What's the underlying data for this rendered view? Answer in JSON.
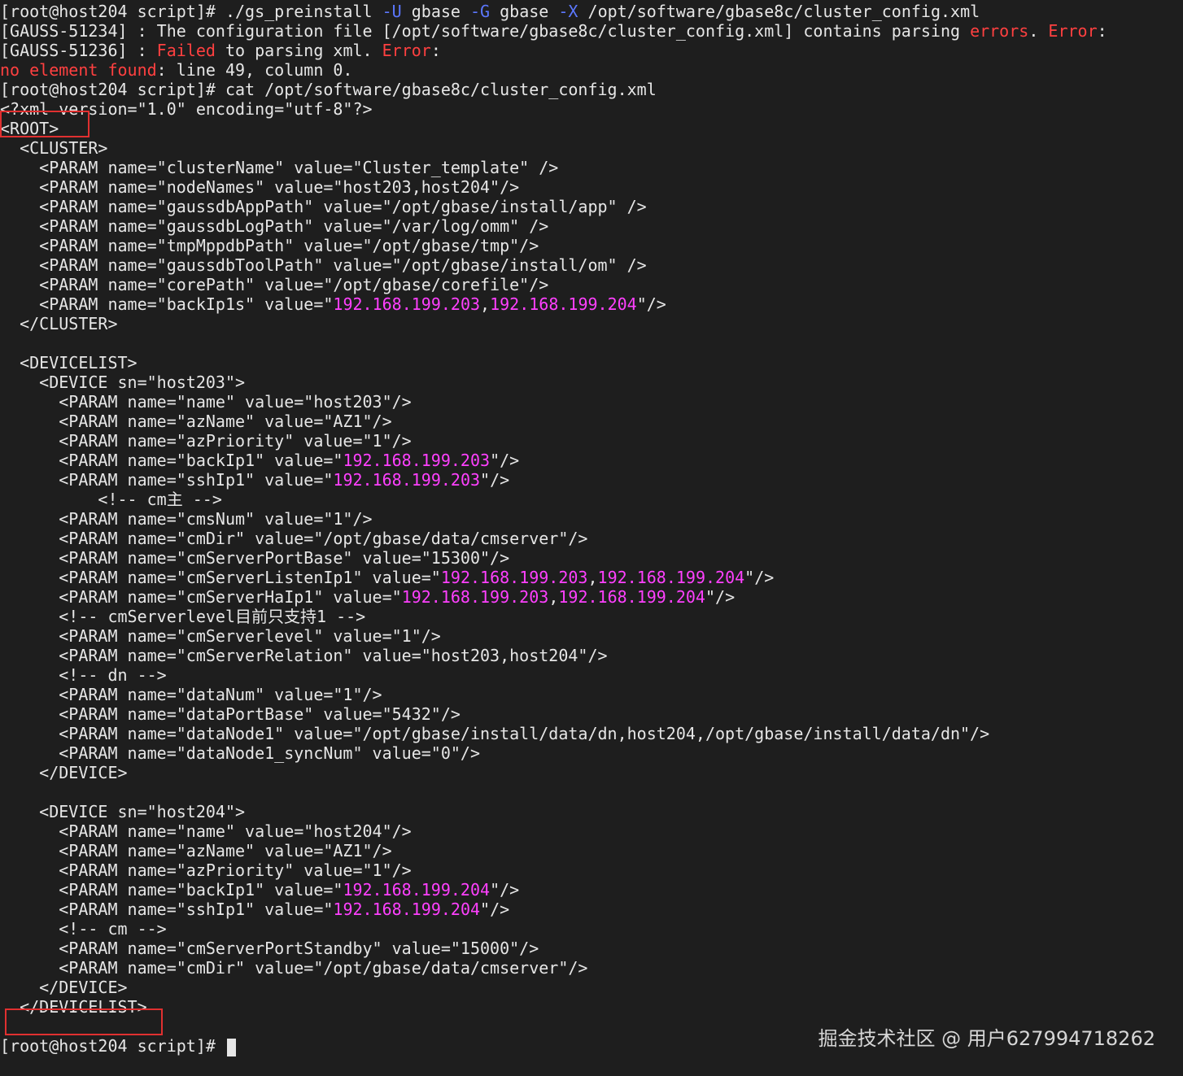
{
  "terminal": {
    "lines": [
      [
        {
          "t": "[root@host204 script]# ./gs_preinstall ",
          "c": "n"
        },
        {
          "t": "-U",
          "c": "b"
        },
        {
          "t": " gbase ",
          "c": "n"
        },
        {
          "t": "-G",
          "c": "b"
        },
        {
          "t": " gbase ",
          "c": "n"
        },
        {
          "t": "-X",
          "c": "b"
        },
        {
          "t": " /opt/software/gbase8c/cluster_config.xml",
          "c": "n"
        }
      ],
      [
        {
          "t": "[GAUSS-51234] : The configuration file [/opt/software/gbase8c/cluster_config.xml] contains parsing ",
          "c": "n"
        },
        {
          "t": "errors",
          "c": "r"
        },
        {
          "t": ". ",
          "c": "n"
        },
        {
          "t": "Error",
          "c": "r"
        },
        {
          "t": ":",
          "c": "n"
        }
      ],
      [
        {
          "t": "[GAUSS-51236] : ",
          "c": "n"
        },
        {
          "t": "Failed",
          "c": "r"
        },
        {
          "t": " to parsing xml. ",
          "c": "n"
        },
        {
          "t": "Error",
          "c": "r"
        },
        {
          "t": ":",
          "c": "n"
        }
      ],
      [
        {
          "t": "no element found",
          "c": "r"
        },
        {
          "t": ": line 49, column 0.",
          "c": "n"
        }
      ],
      [
        {
          "t": "[root@host204 script]# cat /opt/software/gbase8c/cluster_config.xml",
          "c": "n"
        }
      ],
      [
        {
          "t": "<?xml version=\"1.0\" encoding=\"utf-8\"?>",
          "c": "n"
        }
      ],
      [
        {
          "t": "<ROOT>",
          "c": "n"
        }
      ],
      [
        {
          "t": "  <CLUSTER>",
          "c": "n"
        }
      ],
      [
        {
          "t": "    <PARAM name=\"clusterName\" value=\"Cluster_template\" />",
          "c": "n"
        }
      ],
      [
        {
          "t": "    <PARAM name=\"nodeNames\" value=\"host203,host204\"/>",
          "c": "n"
        }
      ],
      [
        {
          "t": "    <PARAM name=\"gaussdbAppPath\" value=\"/opt/gbase/install/app\" />",
          "c": "n"
        }
      ],
      [
        {
          "t": "    <PARAM name=\"gaussdbLogPath\" value=\"/var/log/omm\" />",
          "c": "n"
        }
      ],
      [
        {
          "t": "    <PARAM name=\"tmpMppdbPath\" value=\"/opt/gbase/tmp\"/>",
          "c": "n"
        }
      ],
      [
        {
          "t": "    <PARAM name=\"gaussdbToolPath\" value=\"/opt/gbase/install/om\" />",
          "c": "n"
        }
      ],
      [
        {
          "t": "    <PARAM name=\"corePath\" value=\"/opt/gbase/corefile\"/>",
          "c": "n"
        }
      ],
      [
        {
          "t": "    <PARAM name=\"backIp1s\" value=\"",
          "c": "n"
        },
        {
          "t": "192.168.199.203",
          "c": "m"
        },
        {
          "t": ",",
          "c": "n"
        },
        {
          "t": "192.168.199.204",
          "c": "m"
        },
        {
          "t": "\"/>",
          "c": "n"
        }
      ],
      [
        {
          "t": "  </CLUSTER>",
          "c": "n"
        }
      ],
      [
        {
          "t": "",
          "c": "n"
        }
      ],
      [
        {
          "t": "  <DEVICELIST>",
          "c": "n"
        }
      ],
      [
        {
          "t": "    <DEVICE sn=\"host203\">",
          "c": "n"
        }
      ],
      [
        {
          "t": "      <PARAM name=\"name\" value=\"host203\"/>",
          "c": "n"
        }
      ],
      [
        {
          "t": "      <PARAM name=\"azName\" value=\"AZ1\"/>",
          "c": "n"
        }
      ],
      [
        {
          "t": "      <PARAM name=\"azPriority\" value=\"1\"/>",
          "c": "n"
        }
      ],
      [
        {
          "t": "      <PARAM name=\"backIp1\" value=\"",
          "c": "n"
        },
        {
          "t": "192.168.199.203",
          "c": "m"
        },
        {
          "t": "\"/>",
          "c": "n"
        }
      ],
      [
        {
          "t": "      <PARAM name=\"sshIp1\" value=\"",
          "c": "n"
        },
        {
          "t": "192.168.199.203",
          "c": "m"
        },
        {
          "t": "\"/>",
          "c": "n"
        }
      ],
      [
        {
          "t": "          <!-- cm主 -->",
          "c": "n"
        }
      ],
      [
        {
          "t": "      <PARAM name=\"cmsNum\" value=\"1\"/>",
          "c": "n"
        }
      ],
      [
        {
          "t": "      <PARAM name=\"cmDir\" value=\"/opt/gbase/data/cmserver\"/>",
          "c": "n"
        }
      ],
      [
        {
          "t": "      <PARAM name=\"cmServerPortBase\" value=\"15300\"/>",
          "c": "n"
        }
      ],
      [
        {
          "t": "      <PARAM name=\"cmServerListenIp1\" value=\"",
          "c": "n"
        },
        {
          "t": "192.168.199.203",
          "c": "m"
        },
        {
          "t": ",",
          "c": "n"
        },
        {
          "t": "192.168.199.204",
          "c": "m"
        },
        {
          "t": "\"/>",
          "c": "n"
        }
      ],
      [
        {
          "t": "      <PARAM name=\"cmServerHaIp1\" value=\"",
          "c": "n"
        },
        {
          "t": "192.168.199.203",
          "c": "m"
        },
        {
          "t": ",",
          "c": "n"
        },
        {
          "t": "192.168.199.204",
          "c": "m"
        },
        {
          "t": "\"/>",
          "c": "n"
        }
      ],
      [
        {
          "t": "      <!-- cmServerlevel目前只支持1 -->",
          "c": "n"
        }
      ],
      [
        {
          "t": "      <PARAM name=\"cmServerlevel\" value=\"1\"/>",
          "c": "n"
        }
      ],
      [
        {
          "t": "      <PARAM name=\"cmServerRelation\" value=\"host203,host204\"/>",
          "c": "n"
        }
      ],
      [
        {
          "t": "      <!-- dn -->",
          "c": "n"
        }
      ],
      [
        {
          "t": "      <PARAM name=\"dataNum\" value=\"1\"/>",
          "c": "n"
        }
      ],
      [
        {
          "t": "      <PARAM name=\"dataPortBase\" value=\"5432\"/>",
          "c": "n"
        }
      ],
      [
        {
          "t": "      <PARAM name=\"dataNode1\" value=\"/opt/gbase/install/data/dn,host204,/opt/gbase/install/data/dn\"/>",
          "c": "n"
        }
      ],
      [
        {
          "t": "      <PARAM name=\"dataNode1_syncNum\" value=\"0\"/>",
          "c": "n"
        }
      ],
      [
        {
          "t": "    </DEVICE>",
          "c": "n"
        }
      ],
      [
        {
          "t": "",
          "c": "n"
        }
      ],
      [
        {
          "t": "    <DEVICE sn=\"host204\">",
          "c": "n"
        }
      ],
      [
        {
          "t": "      <PARAM name=\"name\" value=\"host204\"/>",
          "c": "n"
        }
      ],
      [
        {
          "t": "      <PARAM name=\"azName\" value=\"AZ1\"/>",
          "c": "n"
        }
      ],
      [
        {
          "t": "      <PARAM name=\"azPriority\" value=\"1\"/>",
          "c": "n"
        }
      ],
      [
        {
          "t": "      <PARAM name=\"backIp1\" value=\"",
          "c": "n"
        },
        {
          "t": "192.168.199.204",
          "c": "m"
        },
        {
          "t": "\"/>",
          "c": "n"
        }
      ],
      [
        {
          "t": "      <PARAM name=\"sshIp1\" value=\"",
          "c": "n"
        },
        {
          "t": "192.168.199.204",
          "c": "m"
        },
        {
          "t": "\"/>",
          "c": "n"
        }
      ],
      [
        {
          "t": "      <!-- cm -->",
          "c": "n"
        }
      ],
      [
        {
          "t": "      <PARAM name=\"cmServerPortStandby\" value=\"15000\"/>",
          "c": "n"
        }
      ],
      [
        {
          "t": "      <PARAM name=\"cmDir\" value=\"/opt/gbase/data/cmserver\"/>",
          "c": "n"
        }
      ],
      [
        {
          "t": "    </DEVICE>",
          "c": "n"
        }
      ],
      [
        {
          "t": "  </DEVICELIST>",
          "c": "n"
        }
      ],
      [
        {
          "t": "",
          "c": "n"
        }
      ],
      [
        {
          "t": "[root@host204 script]# ",
          "c": "n"
        }
      ]
    ]
  },
  "colors": {
    "background": "#1e1e1e",
    "text": "#e6e6e6",
    "error_red": "#ff4040",
    "option_blue": "#5c78ff",
    "ip_magenta": "#ff40ff",
    "highlight_box": "#e03030"
  },
  "watermark": {
    "text": "掘金技术社区 @ 用户627994718262"
  }
}
